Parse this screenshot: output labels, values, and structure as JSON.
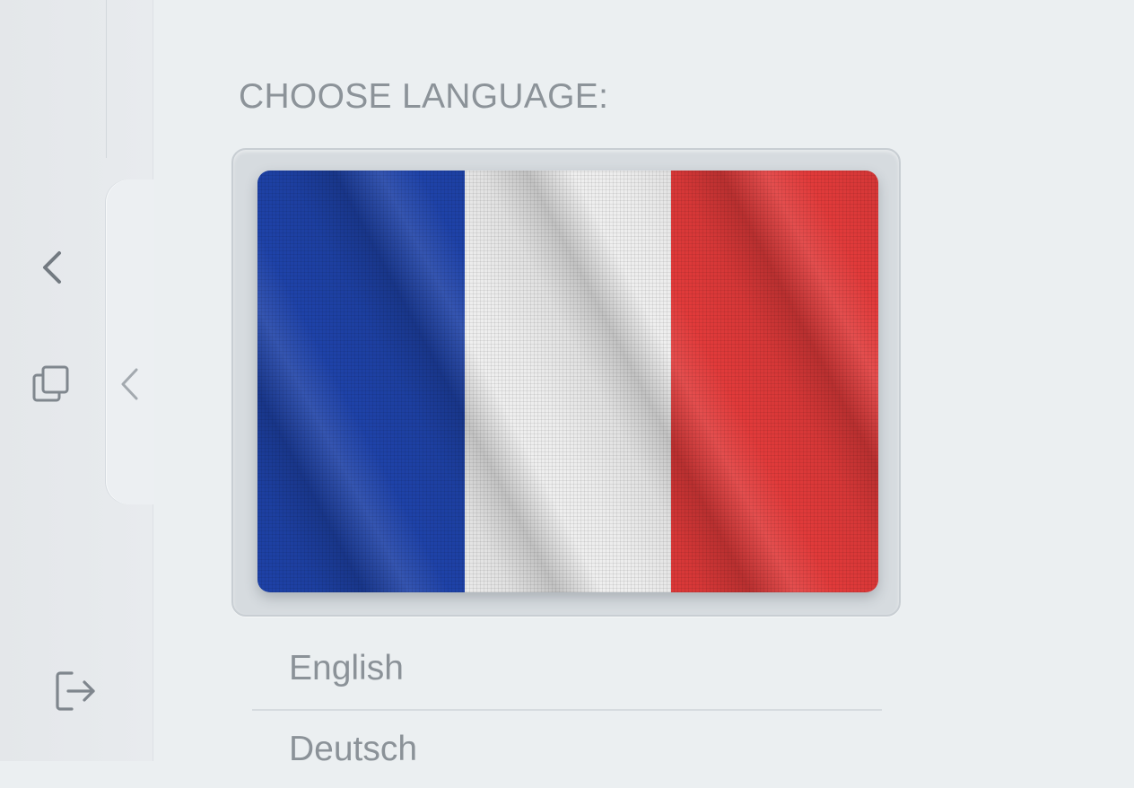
{
  "sidebar": {
    "back_icon": "chevron-left-icon",
    "copy_icon": "copy-icon",
    "collapse_icon": "chevron-left-icon",
    "logout_icon": "logout-icon"
  },
  "main": {
    "section_label": "CHOOSE LANGUAGE:",
    "selected_flag": {
      "icon": "france-flag-icon",
      "colors": [
        "#1e42a8",
        "#ededed",
        "#e13a3a"
      ]
    },
    "languages": [
      {
        "label": "English"
      },
      {
        "label": "Deutsch"
      }
    ]
  },
  "colors": {
    "background": "#ebeff1",
    "sidebar": "#e6e9ec",
    "text_muted": "#8b9298"
  }
}
